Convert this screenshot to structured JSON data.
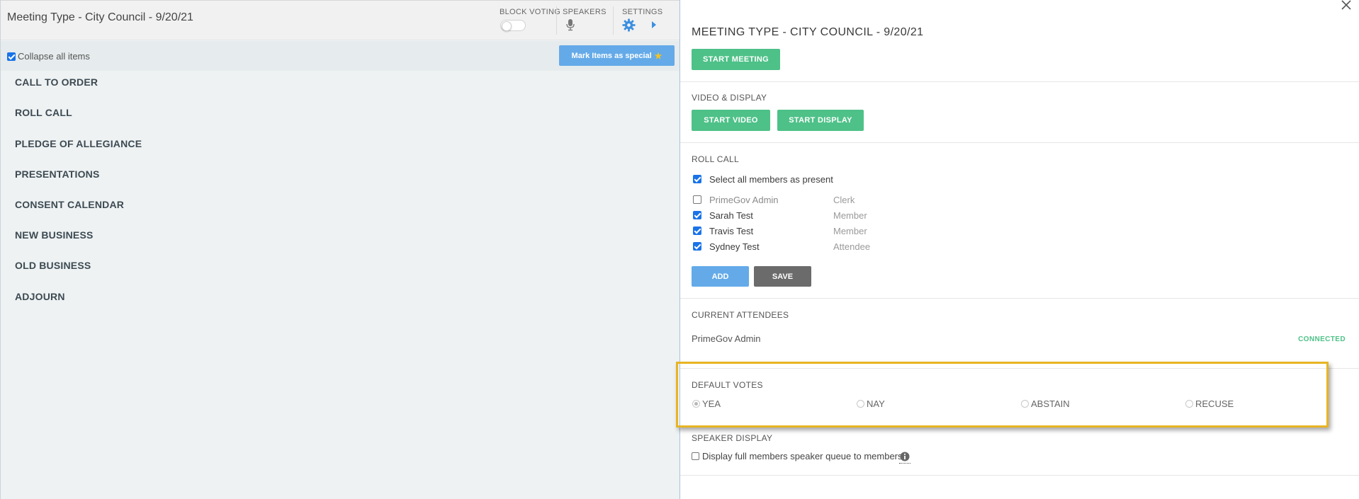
{
  "left": {
    "title": "Meeting Type - City Council - 9/20/21",
    "header": {
      "block_voting_label": "BLOCK VOTING",
      "speakers_label": "SPEAKERS",
      "settings_label": "SETTINGS"
    },
    "collapse_label": "Collapse all items",
    "mark_special_label": "Mark Items as special",
    "agenda_items": [
      "CALL TO ORDER",
      "ROLL CALL",
      "PLEDGE OF ALLEGIANCE",
      "PRESENTATIONS",
      "CONSENT CALENDAR",
      "NEW BUSINESS",
      "OLD BUSINESS",
      "ADJOURN"
    ]
  },
  "right": {
    "title": "MEETING TYPE - CITY COUNCIL - 9/20/21",
    "start_meeting_label": "START MEETING",
    "video_display": {
      "section_label": "VIDEO & DISPLAY",
      "start_video_label": "START VIDEO",
      "start_display_label": "START DISPLAY"
    },
    "roll_call": {
      "section_label": "ROLL CALL",
      "select_all_label": "Select all members as present",
      "members": [
        {
          "name": "PrimeGov Admin",
          "role": "Clerk",
          "present": false
        },
        {
          "name": "Sarah Test",
          "role": "Member",
          "present": true
        },
        {
          "name": "Travis Test",
          "role": "Member",
          "present": true
        },
        {
          "name": "Sydney Test",
          "role": "Attendee",
          "present": true
        }
      ],
      "add_label": "ADD",
      "save_label": "SAVE"
    },
    "current_attendees": {
      "section_label": "CURRENT ATTENDEES",
      "attendees": [
        {
          "name": "PrimeGov Admin",
          "status": "CONNECTED"
        }
      ]
    },
    "default_votes": {
      "section_label": "DEFAULT VOTES",
      "options": [
        "YEA",
        "NAY",
        "ABSTAIN",
        "RECUSE"
      ],
      "selected": "YEA"
    },
    "speaker_display": {
      "section_label": "SPEAKER DISPLAY",
      "option_label": "Display full members speaker queue to members"
    }
  },
  "colors": {
    "green": "#4ec188",
    "blue": "#64aae8",
    "gray_button": "#6b6b6b",
    "highlight": "#e7b524",
    "left_bg": "#eef2f3"
  }
}
